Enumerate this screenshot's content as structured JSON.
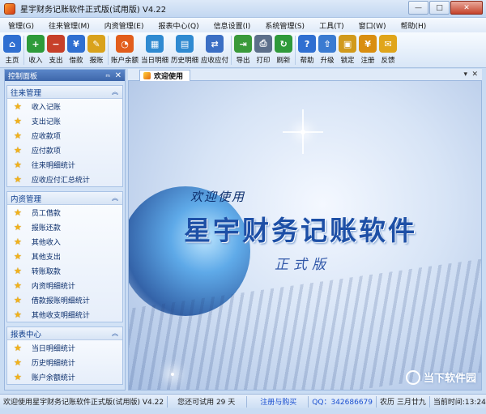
{
  "window": {
    "title": "星宇财务记账软件正式版(试用版) V4.22",
    "minimize": "—",
    "maximize": "□",
    "close": "✕"
  },
  "menu": [
    "管理(G)",
    "往来管理(M)",
    "内资管理(E)",
    "报表中心(Q)",
    "信息设置(I)",
    "系统管理(S)",
    "工具(T)",
    "窗口(W)",
    "帮助(H)"
  ],
  "toolbar": [
    {
      "label": "主页",
      "icon": "home-icon",
      "color": "#2f6fd1"
    },
    {
      "label": "收入",
      "icon": "income-icon",
      "color": "#2e9b3a"
    },
    {
      "label": "支出",
      "icon": "expense-icon",
      "color": "#c7402a"
    },
    {
      "label": "借款",
      "icon": "loan-icon",
      "color": "#2f6fd1"
    },
    {
      "label": "报账",
      "icon": "reimburse-icon",
      "color": "#d9a21c"
    },
    {
      "label": "账户余额",
      "icon": "balance-icon",
      "color": "#e25d1b"
    },
    {
      "label": "当日明细",
      "icon": "daily-detail-icon",
      "color": "#2f8ad1"
    },
    {
      "label": "历史明细",
      "icon": "history-detail-icon",
      "color": "#2f8ad1"
    },
    {
      "label": "应收应付",
      "icon": "receivable-payable-icon",
      "color": "#3b6fc4"
    },
    {
      "label": "导出",
      "icon": "export-icon",
      "color": "#3a9a3a"
    },
    {
      "label": "打印",
      "icon": "print-icon",
      "color": "#5c6f8a"
    },
    {
      "label": "刷新",
      "icon": "refresh-icon",
      "color": "#2f9a3a"
    },
    {
      "label": "帮助",
      "icon": "help-icon",
      "color": "#2f6fd1"
    },
    {
      "label": "升级",
      "icon": "upgrade-icon",
      "color": "#3a7bd1"
    },
    {
      "label": "锁定",
      "icon": "lock-icon",
      "color": "#d19a1c"
    },
    {
      "label": "注册",
      "icon": "register-icon",
      "color": "#d98e10"
    },
    {
      "label": "反馈",
      "icon": "feedback-icon",
      "color": "#e0a51a"
    }
  ],
  "panel": {
    "title": "控制面板",
    "pin": "ₘ",
    "close": "✕"
  },
  "groups": [
    {
      "title": "往来管理",
      "items": [
        "收入记账",
        "支出记账",
        "应收款项",
        "应付款项",
        "往来明细统计",
        "应收应付汇总统计"
      ]
    },
    {
      "title": "内资管理",
      "items": [
        "员工借款",
        "报账还款",
        "其他收入",
        "其他支出",
        "转账取款",
        "内资明细统计",
        "借款报账明细统计",
        "其他收支明细统计"
      ]
    },
    {
      "title": "报表中心",
      "items": [
        "当日明细统计",
        "历史明细统计",
        "账户余额统计"
      ]
    }
  ],
  "tab": {
    "label": "欢迎使用",
    "dropdown": "▾",
    "close": "✕"
  },
  "welcome": {
    "line1": "欢迎使用",
    "product": "星宇财务记账软件",
    "edition": "正式版"
  },
  "watermark": "当下软件园",
  "status": {
    "welcome": "欢迎使用星宇财务记账软件正式版(试用版) V4.22",
    "trial": "您还可试用 29 天",
    "register": "注册与购买",
    "qq": "QQ：342686679",
    "lunar": "农历 三月廿九",
    "time": "当前时间:13:24:05"
  }
}
